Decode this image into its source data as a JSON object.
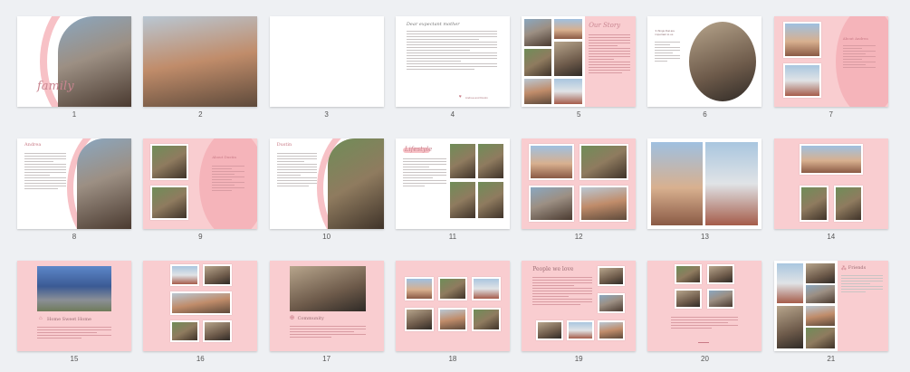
{
  "pages": [
    {
      "n": "1",
      "title": "family"
    },
    {
      "n": "2"
    },
    {
      "n": "3"
    },
    {
      "n": "4",
      "title": "Dear expectant mother",
      "signature": "Andrea and Dustin"
    },
    {
      "n": "5",
      "title": "Our Story"
    },
    {
      "n": "6",
      "title": "3 things that are important to us"
    },
    {
      "n": "7",
      "title": "About Andrea"
    },
    {
      "n": "8",
      "title": "Andrea"
    },
    {
      "n": "9",
      "title": "About Dustin"
    },
    {
      "n": "10",
      "title": "Dustin"
    },
    {
      "n": "11",
      "title": "Lifestyle"
    },
    {
      "n": "12"
    },
    {
      "n": "13"
    },
    {
      "n": "14"
    },
    {
      "n": "15",
      "title": "Home Sweet Home"
    },
    {
      "n": "16"
    },
    {
      "n": "17",
      "title": "Community"
    },
    {
      "n": "18"
    },
    {
      "n": "19",
      "title": "People we love"
    },
    {
      "n": "20"
    },
    {
      "n": "21",
      "title": "Friends"
    }
  ],
  "colors": {
    "background": "#eef0f3",
    "pink": "#f9cdd0",
    "accent": "#c97a86"
  }
}
